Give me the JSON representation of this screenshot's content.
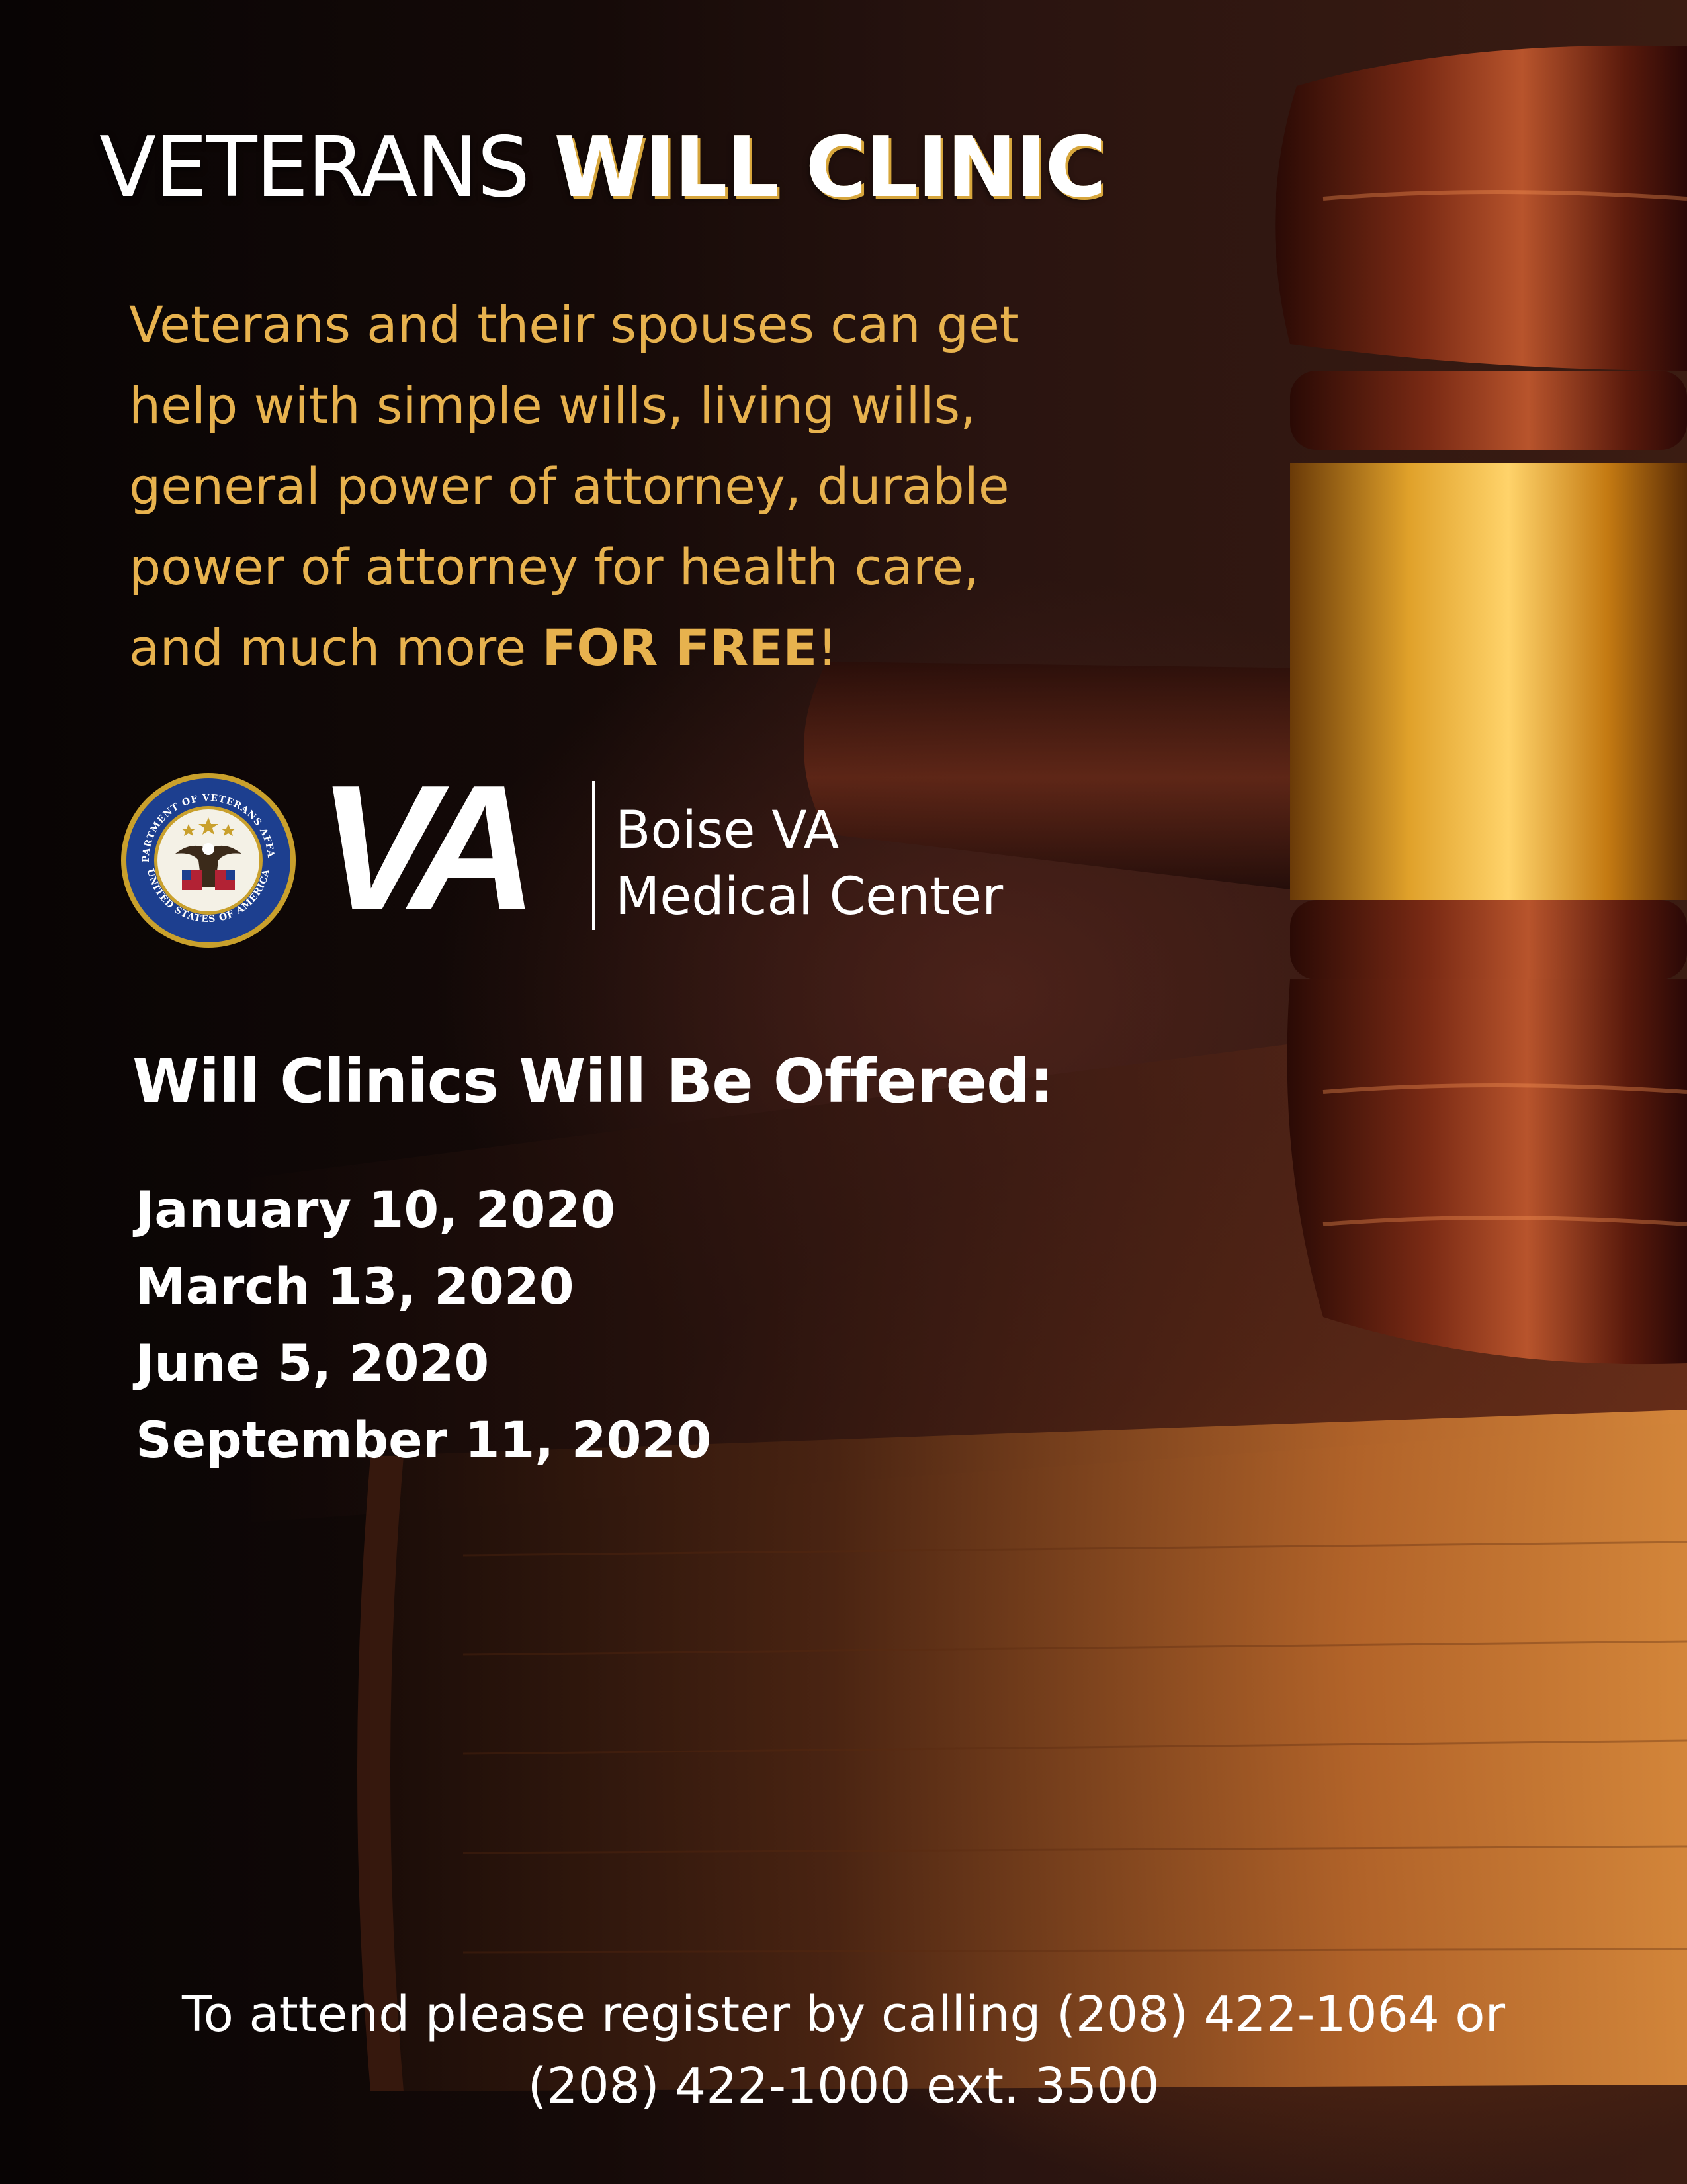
{
  "title": {
    "light": "VETERANS",
    "bold": "WILL CLINIC"
  },
  "intro": {
    "lines": [
      "Veterans and their spouses can get",
      "help with simple wills, living wills,",
      "general power of attorney, durable",
      "power of attorney for health care,"
    ],
    "last_line_prefix": "and much more ",
    "last_line_bold": "FOR FREE",
    "last_line_suffix": "!"
  },
  "logo": {
    "mark": "VA",
    "seal_icon": "department-of-veterans-affairs-seal",
    "seal_text_top": "DEPARTMENT OF VETERANS AFFAIRS",
    "seal_text_bottom": "UNITED STATES OF AMERICA",
    "facility_line1": "Boise VA",
    "facility_line2": "Medical Center"
  },
  "schedule": {
    "heading": "Will Clinics Will Be Offered:",
    "dates": [
      "January 10, 2020",
      "March 13, 2020",
      "June 5, 2020",
      "September 11, 2020"
    ]
  },
  "footer": {
    "line1": "To attend please register by calling (208) 422-1064 or",
    "line2": "(208) 422-1000 ext. 3500"
  },
  "colors": {
    "accent_gold": "#e7b24e",
    "text_white": "#ffffff",
    "background": "#0b0605"
  }
}
